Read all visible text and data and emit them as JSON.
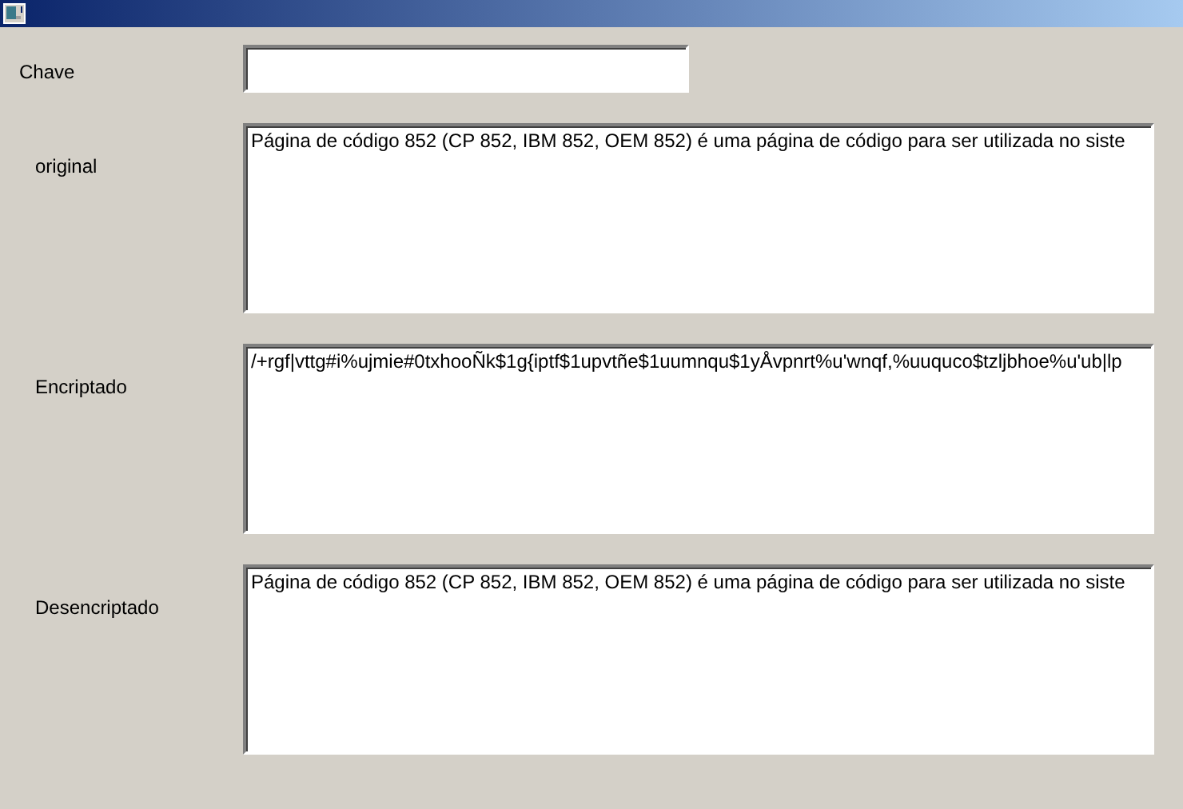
{
  "fields": [
    {
      "kind": "line",
      "label": "Chave"
    },
    {
      "kind": "area",
      "label": "original",
      "value": "Página de código 852 (CP 852, IBM 852, OEM 852) é uma página de código para ser utilizada no siste"
    },
    {
      "kind": "area",
      "label": "Encriptado",
      "value": "/+rgf|vttg#i%ujmie#0txhooÑk$1g{iptf$1upvtñe$1uumnqu$1yÅvpnrt%u'wnqf,%uuquco$tzljbhoe%u'ub|lp"
    },
    {
      "kind": "area",
      "label": "Desencriptado",
      "value": "Página de código 852 (CP 852, IBM 852, OEM 852) é uma página de código para ser utilizada no siste"
    }
  ]
}
